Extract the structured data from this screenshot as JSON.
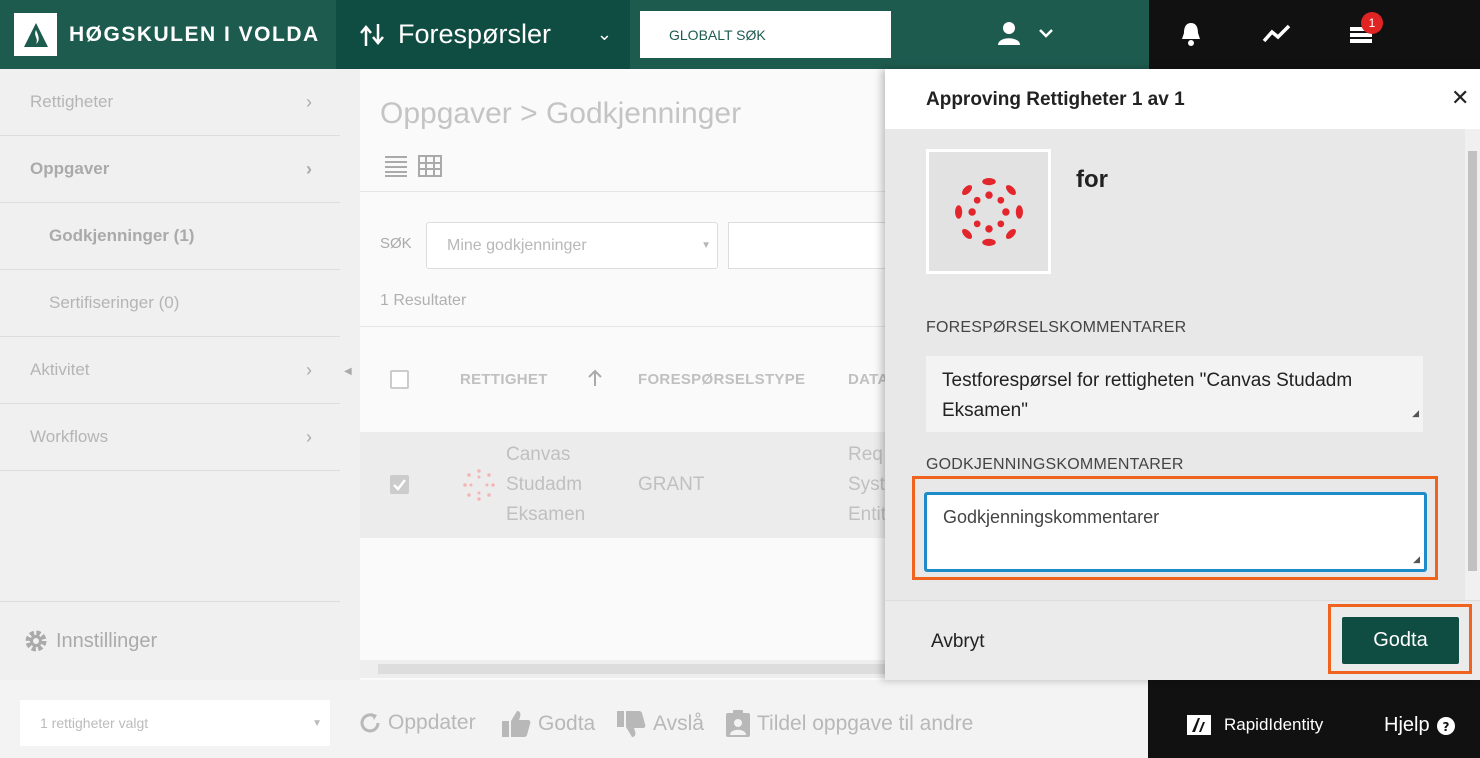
{
  "header": {
    "org_name": "HØGSKULEN I VOLDA",
    "module": "Forespørsler",
    "global_search": "GLOBALT SØK",
    "notification_badge": "1"
  },
  "sidebar": {
    "items": [
      {
        "label": "Rettigheter"
      },
      {
        "label": "Oppgaver"
      },
      {
        "label": "Godkjenninger (1)"
      },
      {
        "label": "Sertifiseringer (0)"
      },
      {
        "label": "Aktivitet"
      },
      {
        "label": "Workflows"
      }
    ],
    "settings": "Innstillinger"
  },
  "main": {
    "title": "Oppgaver > Godkjenninger",
    "search_label": "SØK",
    "search_select": "Mine godkjenninger",
    "results": "1 Resultater",
    "columns": [
      "RETTIGHET",
      "FORESPØRSELSTYPE",
      "DATA"
    ],
    "row": {
      "name_lines": [
        "Canvas",
        "Studadm",
        "Eksamen"
      ],
      "type": "GRANT",
      "data_lines": [
        "Req",
        "Syst",
        "Entit"
      ]
    }
  },
  "footer": {
    "selected": "1 rettigheter valgt",
    "refresh": "Oppdater",
    "approve": "Godta",
    "reject": "Avslå",
    "assign": "Tildel oppgave til andre",
    "brand": "RapidIdentity",
    "help": "Hjelp"
  },
  "panel": {
    "title": "Approving Rettigheter 1 av 1",
    "for_label": "for",
    "request_comments_label": "FORESPØRSELSKOMMENTARER",
    "request_comments": "Testforespørsel for rettigheten \"Canvas Studadm Eksamen\"",
    "approval_comments_label": "GODKJENNINGSKOMMENTARER",
    "approval_comments_placeholder": "Godkjenningskommentarer",
    "cancel": "Avbryt",
    "approve": "Godta"
  },
  "colors": {
    "brand": "#1e5b4f",
    "brand_dark": "#0f4c41",
    "highlight": "#f0631e",
    "focus": "#1f8cc9",
    "canvas_red": "#e3262c"
  }
}
